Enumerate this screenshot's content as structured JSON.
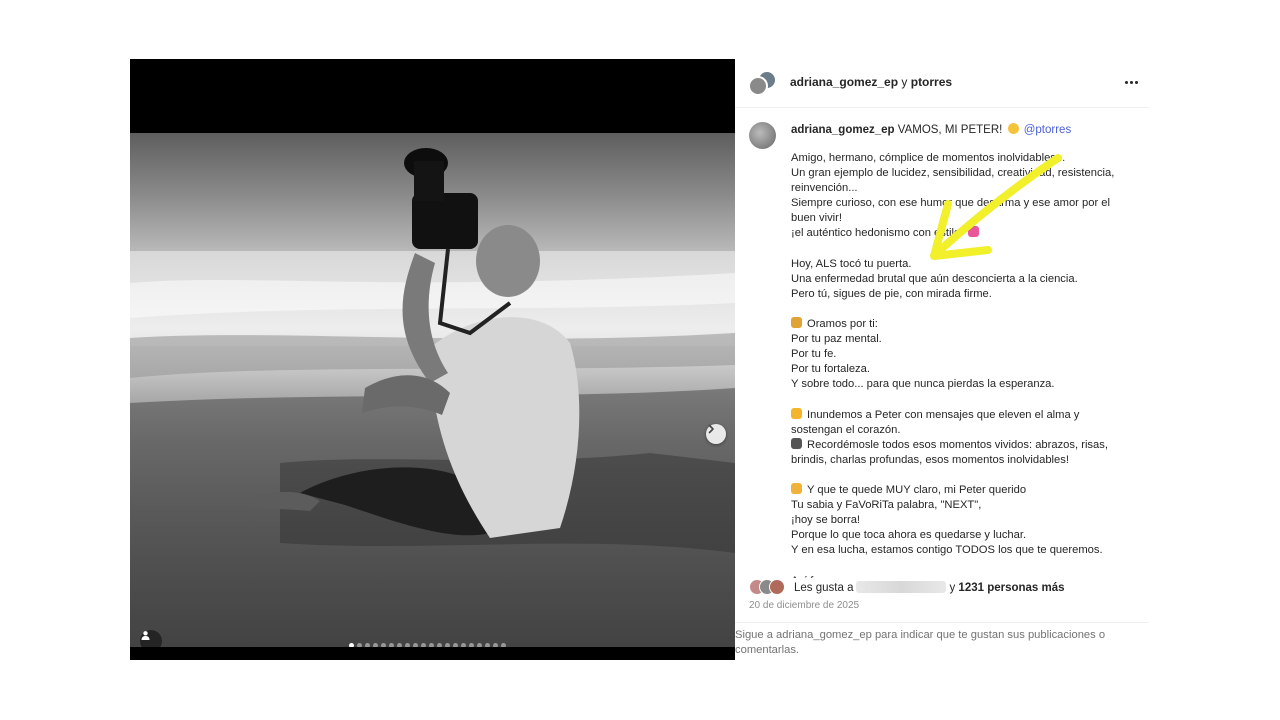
{
  "header": {
    "user1": "adriana_gomez_ep",
    "conjunction": "y",
    "user2": "ptorres"
  },
  "caption": {
    "author": "adriana_gomez_ep",
    "intro": "VAMOS, MI PETER!",
    "mention": "@ptorres",
    "lines": [
      "Amigo, hermano, cómplice de momentos inolvidables...",
      "Un gran ejemplo de lucidez, sensibilidad, creatividad, resistencia,",
      "reinvención...",
      "Siempre curioso, con ese humor que desarma y ese amor por el",
      "buen vivir!",
      "¡el auténtico hedonismo con estilo!",
      "",
      "Hoy, ALS tocó tu puerta.",
      "Una enfermedad brutal que aún desconcierta a la ciencia.",
      "Pero tú, sigues de pie, con mirada firme.",
      "",
      "Oramos por ti:",
      "Por tu paz mental.",
      "Por tu fe.",
      "Por tu fortaleza.",
      "Y sobre todo... para que nunca pierdas la esperanza.",
      "",
      "Inundemos a Peter con mensajes que eleven el alma y",
      "sostengan el corazón.",
      "Recordémosle todos esos momentos vividos: abrazos, risas,",
      "brindis, charlas profundas, esos momentos inolvidables!",
      "",
      "Y que te quede MUY claro, mi Peter querido",
      "Tu sabia y FaVoRiTa palabra, \"NEXT\",",
      "¡hoy se borra!",
      "Porque lo que toca ahora es quedarse y luchar.",
      "Y en esa lucha, estamos contigo TODOS los que te queremos.",
      "",
      "Así fue..."
    ]
  },
  "likes": {
    "prefix": "Les gusta a",
    "middle": "y",
    "count": "1231 personas más"
  },
  "date": "20 de diciembre de 2025",
  "footer": "Sigue a adriana_gomez_ep para indicar que te gustan sus publicaciones o comentarlas.",
  "carousel": {
    "total": 20,
    "active": 1
  },
  "colors": {
    "mention": "#4a5fd4",
    "arrow": "#f2ef2b",
    "secondary": "#8e8e8e"
  },
  "icons": [
    "chevron-right-icon",
    "person-tag-icon",
    "more-options-icon",
    "sun-emoji",
    "pray-emoji",
    "heart-emoji",
    "camera-emoji",
    "point-right-emoji",
    "sparkles-emoji"
  ]
}
